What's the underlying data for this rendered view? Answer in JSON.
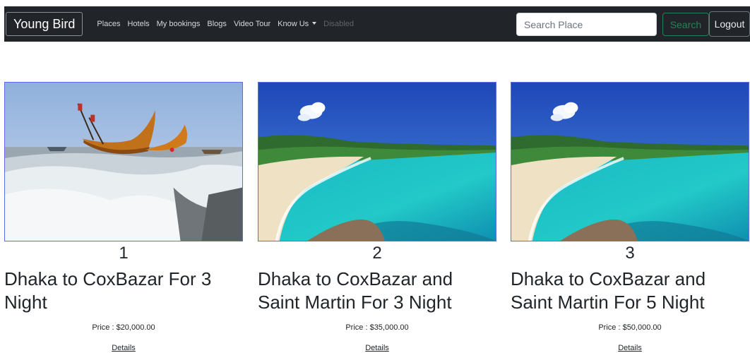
{
  "navbar": {
    "brand": "Young Bird",
    "links": [
      {
        "label": "Places"
      },
      {
        "label": "Hotels"
      },
      {
        "label": "My bookings"
      },
      {
        "label": "Blogs"
      },
      {
        "label": "Video Tour"
      },
      {
        "label": "Know Us"
      },
      {
        "label": "Disabled"
      }
    ],
    "search_placeholder": "Search Place",
    "search_button": "Search",
    "logout_button": "Logout"
  },
  "packages": [
    {
      "number": "1",
      "title": "Dhaka to CoxBazar For 3 Night",
      "price": "Price : $20,000.00",
      "details_label": "Details"
    },
    {
      "number": "2",
      "title": "Dhaka to CoxBazar and Saint Martin For 3 Night",
      "price": "Price : $35,000.00",
      "details_label": "Details"
    },
    {
      "number": "3",
      "title": "Dhaka to CoxBazar and Saint Martin For 5 Night",
      "price": "Price : $50,000.00",
      "details_label": "Details"
    }
  ],
  "colors": {
    "navbar_bg": "#212529",
    "search_accent": "#198754",
    "image_border": "#5b6ee8"
  }
}
